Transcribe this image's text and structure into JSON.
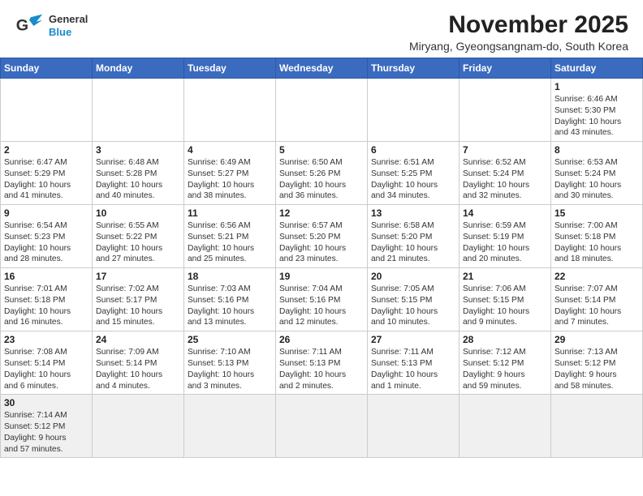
{
  "header": {
    "logo_line1": "General",
    "logo_line2": "Blue",
    "month_title": "November 2025",
    "subtitle": "Miryang, Gyeongsangnam-do, South Korea"
  },
  "days_of_week": [
    "Sunday",
    "Monday",
    "Tuesday",
    "Wednesday",
    "Thursday",
    "Friday",
    "Saturday"
  ],
  "weeks": [
    [
      {
        "day": "",
        "info": ""
      },
      {
        "day": "",
        "info": ""
      },
      {
        "day": "",
        "info": ""
      },
      {
        "day": "",
        "info": ""
      },
      {
        "day": "",
        "info": ""
      },
      {
        "day": "",
        "info": ""
      },
      {
        "day": "1",
        "info": "Sunrise: 6:46 AM\nSunset: 5:30 PM\nDaylight: 10 hours\nand 43 minutes."
      }
    ],
    [
      {
        "day": "2",
        "info": "Sunrise: 6:47 AM\nSunset: 5:29 PM\nDaylight: 10 hours\nand 41 minutes."
      },
      {
        "day": "3",
        "info": "Sunrise: 6:48 AM\nSunset: 5:28 PM\nDaylight: 10 hours\nand 40 minutes."
      },
      {
        "day": "4",
        "info": "Sunrise: 6:49 AM\nSunset: 5:27 PM\nDaylight: 10 hours\nand 38 minutes."
      },
      {
        "day": "5",
        "info": "Sunrise: 6:50 AM\nSunset: 5:26 PM\nDaylight: 10 hours\nand 36 minutes."
      },
      {
        "day": "6",
        "info": "Sunrise: 6:51 AM\nSunset: 5:25 PM\nDaylight: 10 hours\nand 34 minutes."
      },
      {
        "day": "7",
        "info": "Sunrise: 6:52 AM\nSunset: 5:24 PM\nDaylight: 10 hours\nand 32 minutes."
      },
      {
        "day": "8",
        "info": "Sunrise: 6:53 AM\nSunset: 5:24 PM\nDaylight: 10 hours\nand 30 minutes."
      }
    ],
    [
      {
        "day": "9",
        "info": "Sunrise: 6:54 AM\nSunset: 5:23 PM\nDaylight: 10 hours\nand 28 minutes."
      },
      {
        "day": "10",
        "info": "Sunrise: 6:55 AM\nSunset: 5:22 PM\nDaylight: 10 hours\nand 27 minutes."
      },
      {
        "day": "11",
        "info": "Sunrise: 6:56 AM\nSunset: 5:21 PM\nDaylight: 10 hours\nand 25 minutes."
      },
      {
        "day": "12",
        "info": "Sunrise: 6:57 AM\nSunset: 5:20 PM\nDaylight: 10 hours\nand 23 minutes."
      },
      {
        "day": "13",
        "info": "Sunrise: 6:58 AM\nSunset: 5:20 PM\nDaylight: 10 hours\nand 21 minutes."
      },
      {
        "day": "14",
        "info": "Sunrise: 6:59 AM\nSunset: 5:19 PM\nDaylight: 10 hours\nand 20 minutes."
      },
      {
        "day": "15",
        "info": "Sunrise: 7:00 AM\nSunset: 5:18 PM\nDaylight: 10 hours\nand 18 minutes."
      }
    ],
    [
      {
        "day": "16",
        "info": "Sunrise: 7:01 AM\nSunset: 5:18 PM\nDaylight: 10 hours\nand 16 minutes."
      },
      {
        "day": "17",
        "info": "Sunrise: 7:02 AM\nSunset: 5:17 PM\nDaylight: 10 hours\nand 15 minutes."
      },
      {
        "day": "18",
        "info": "Sunrise: 7:03 AM\nSunset: 5:16 PM\nDaylight: 10 hours\nand 13 minutes."
      },
      {
        "day": "19",
        "info": "Sunrise: 7:04 AM\nSunset: 5:16 PM\nDaylight: 10 hours\nand 12 minutes."
      },
      {
        "day": "20",
        "info": "Sunrise: 7:05 AM\nSunset: 5:15 PM\nDaylight: 10 hours\nand 10 minutes."
      },
      {
        "day": "21",
        "info": "Sunrise: 7:06 AM\nSunset: 5:15 PM\nDaylight: 10 hours\nand 9 minutes."
      },
      {
        "day": "22",
        "info": "Sunrise: 7:07 AM\nSunset: 5:14 PM\nDaylight: 10 hours\nand 7 minutes."
      }
    ],
    [
      {
        "day": "23",
        "info": "Sunrise: 7:08 AM\nSunset: 5:14 PM\nDaylight: 10 hours\nand 6 minutes."
      },
      {
        "day": "24",
        "info": "Sunrise: 7:09 AM\nSunset: 5:14 PM\nDaylight: 10 hours\nand 4 minutes."
      },
      {
        "day": "25",
        "info": "Sunrise: 7:10 AM\nSunset: 5:13 PM\nDaylight: 10 hours\nand 3 minutes."
      },
      {
        "day": "26",
        "info": "Sunrise: 7:11 AM\nSunset: 5:13 PM\nDaylight: 10 hours\nand 2 minutes."
      },
      {
        "day": "27",
        "info": "Sunrise: 7:11 AM\nSunset: 5:13 PM\nDaylight: 10 hours\nand 1 minute."
      },
      {
        "day": "28",
        "info": "Sunrise: 7:12 AM\nSunset: 5:12 PM\nDaylight: 9 hours\nand 59 minutes."
      },
      {
        "day": "29",
        "info": "Sunrise: 7:13 AM\nSunset: 5:12 PM\nDaylight: 9 hours\nand 58 minutes."
      }
    ],
    [
      {
        "day": "30",
        "info": "Sunrise: 7:14 AM\nSunset: 5:12 PM\nDaylight: 9 hours\nand 57 minutes."
      },
      {
        "day": "",
        "info": ""
      },
      {
        "day": "",
        "info": ""
      },
      {
        "day": "",
        "info": ""
      },
      {
        "day": "",
        "info": ""
      },
      {
        "day": "",
        "info": ""
      },
      {
        "day": "",
        "info": ""
      }
    ]
  ]
}
